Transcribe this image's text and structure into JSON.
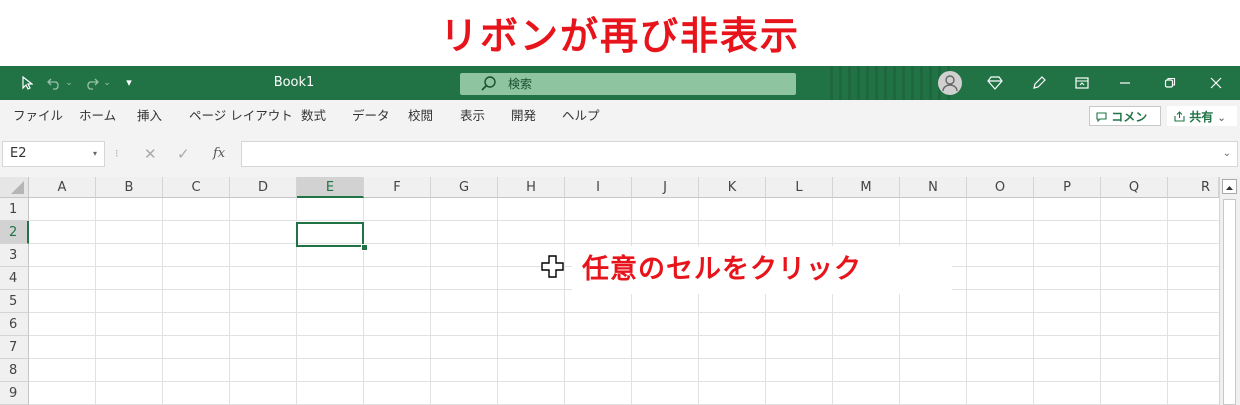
{
  "annotation": {
    "title": "リボンが再び非表示",
    "callout": "任意のセルをクリック"
  },
  "titlebar": {
    "book_name": "Book1",
    "search_placeholder": "検索"
  },
  "menu": {
    "items": [
      "ファイル",
      "ホーム",
      "挿入",
      "ページ レイアウト",
      "数式",
      "データ",
      "校閲",
      "表示",
      "開発",
      "ヘルプ"
    ],
    "comment_button": "コメント",
    "share_button": "共有"
  },
  "formula_bar": {
    "name_box": "E2",
    "fx_label": "fx",
    "formula_value": ""
  },
  "sheet": {
    "columns": [
      "A",
      "B",
      "C",
      "D",
      "E",
      "F",
      "G",
      "H",
      "I",
      "J",
      "K",
      "L",
      "M",
      "N",
      "O",
      "P",
      "Q",
      "R"
    ],
    "rows": [
      "1",
      "2",
      "3",
      "4",
      "5",
      "6",
      "7",
      "8",
      "9"
    ],
    "active_cell": "E2"
  },
  "colors": {
    "excel_green": "#217346",
    "annotation_red": "#e8141c"
  }
}
